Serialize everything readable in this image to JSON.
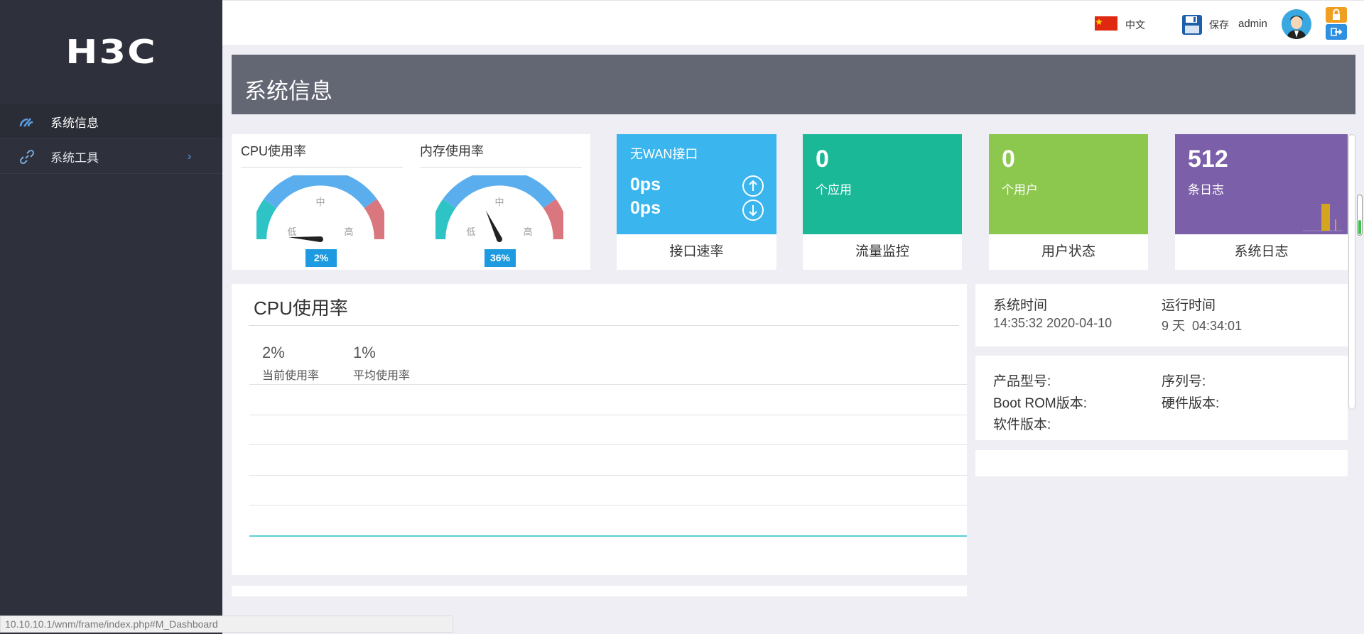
{
  "sidebar": {
    "logo": "H3C",
    "items": [
      {
        "label": "系统信息",
        "icon": "gauge-icon"
      },
      {
        "label": "系统工具",
        "icon": "link-icon"
      }
    ]
  },
  "topbar": {
    "language": "中文",
    "save_label": "保存",
    "username": "admin"
  },
  "page": {
    "title": "系统信息"
  },
  "gauges": [
    {
      "title": "CPU使用率",
      "value_label": "2%",
      "value": 2,
      "low": "低",
      "mid": "中",
      "high": "高"
    },
    {
      "title": "内存使用率",
      "value_label": "36%",
      "value": 36,
      "low": "低",
      "mid": "中",
      "high": "高"
    }
  ],
  "tiles": {
    "interface": {
      "title": "无WAN接口",
      "rate_up": "0ps",
      "rate_down": "0ps",
      "footer": "接口速率",
      "color": "#3ab5ee"
    },
    "traffic": {
      "count": "0",
      "unit": "个应用",
      "footer": "流量监控",
      "color": "#1bb898"
    },
    "users": {
      "count": "0",
      "unit": "个用户",
      "footer": "用户状态",
      "color": "#8cc74e"
    },
    "logs": {
      "count": "512",
      "unit": "条日志",
      "footer": "系统日志",
      "color": "#7b5fa8"
    }
  },
  "cpu_panel": {
    "title": "CPU使用率",
    "current_value": "2%",
    "current_label": "当前使用率",
    "avg_value": "1%",
    "avg_label": "平均使用率"
  },
  "system_info": {
    "time_label": "系统时间",
    "time_value": "14:35:32 2020-04-10",
    "uptime_label": "运行时间",
    "uptime_value": "9 天  04:34:01",
    "model_label": "产品型号:",
    "serial_label": "序列号:",
    "bootrom_label": "Boot ROM版本:",
    "hardware_label": "硬件版本:",
    "software_label": "软件版本:"
  },
  "status_bar": {
    "url": "10.10.10.1/wnm/frame/index.php#M_Dashboard"
  },
  "colors": {
    "sidebar_bg": "#2e313b",
    "header_bg": "#636673",
    "accent_blue": "#1e9ae0",
    "gauge_teal": "#2ec4c6",
    "gauge_blue": "#5aaeee",
    "gauge_red": "#d9767e"
  }
}
